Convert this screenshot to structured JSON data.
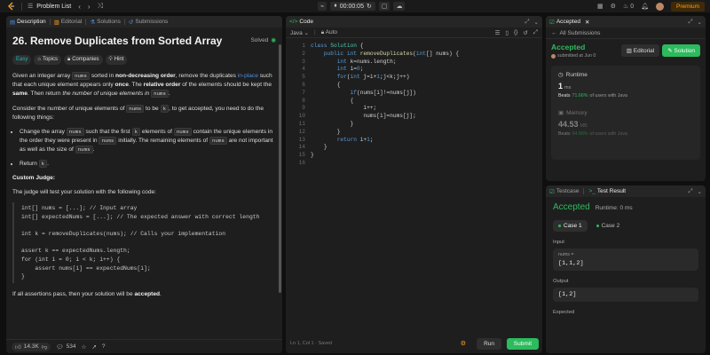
{
  "topbar": {
    "title": "Problem List",
    "timer": "00:00:05",
    "fire_count": "0",
    "premium": "Premium"
  },
  "description": {
    "tabs": [
      "Description",
      "Editorial",
      "Solutions",
      "Submissions"
    ],
    "title": "26. Remove Duplicates from Sorted Array",
    "solved": "Solved",
    "tags": [
      "Easy",
      "Topics",
      "Companies",
      "Hint"
    ],
    "p1": [
      "Given an integer array ",
      "nums",
      " sorted in ",
      "non-decreasing order",
      ", remove the duplicates ",
      "in-place",
      " such that each unique element appears only ",
      "once",
      ". The ",
      "relative order",
      " of the elements should be kept the ",
      "same",
      ". Then return ",
      "the number of unique elements in",
      " ",
      "nums",
      "."
    ],
    "p2": [
      "Consider the number of unique elements of ",
      "nums",
      " to be ",
      "k",
      ", to get accepted, you need to do the following things:"
    ],
    "bullet1": [
      "Change the array ",
      "nums",
      " such that the first ",
      "k",
      " elements of ",
      "nums",
      " contain the unique elements in the order they were present in ",
      "nums",
      " initially. The remaining elements of ",
      "nums",
      " are not important as well as the size of ",
      "nums",
      "."
    ],
    "bullet2": [
      "Return ",
      "k",
      "."
    ],
    "custom_judge": "Custom Judge:",
    "judge_intro": "The judge will test your solution with the following code:",
    "judge_code": "int[] nums = [...]; // Input array\nint[] expectedNums = [...]; // The expected answer with correct length\n\nint k = removeDuplicates(nums); // Calls your implementation\n\nassert k == expectedNums.length;\nfor (int i = 0; i < k; i++) {\n    assert nums[i] == expectedNums[i];\n}",
    "p_end": [
      "If all assertions pass, then your solution will be ",
      "accepted",
      "."
    ],
    "footer": {
      "likes": "14.3K",
      "comments": "534"
    }
  },
  "code": {
    "tab": "Code",
    "language": "Java",
    "mode": "Auto",
    "line_numbers": [
      "1",
      "2",
      "3",
      "4",
      "5",
      "6",
      "7",
      "8",
      "9",
      "10",
      "11",
      "12",
      "13",
      "14",
      "15",
      "16"
    ],
    "status": "Ln 1, Col 1  ·  Saved",
    "run": "Run",
    "submit": "Submit"
  },
  "accepted": {
    "tab": "Accepted",
    "back": "All Submissions",
    "status": "Accepted",
    "submitted": "submitted at Jun 0",
    "editorial": "Editorial",
    "solution": "Solution",
    "runtime_label": "Runtime",
    "runtime_value": "1",
    "runtime_unit": "ms",
    "runtime_beats": "Beats",
    "runtime_pct": "71.66%",
    "runtime_tail": "of users with Java",
    "memory_label": "Memory",
    "memory_value": "44.53",
    "memory_unit": "MB",
    "memory_beats": "Beats",
    "memory_pct": "94.88%",
    "memory_tail": "of users with Java"
  },
  "test": {
    "tabs": [
      "Testcase",
      "Test Result"
    ],
    "status": "Accepted",
    "runtime": "Runtime: 0 ms",
    "cases": [
      "Case 1",
      "Case 2"
    ],
    "input_label": "Input",
    "var_name": "nums =",
    "input": "[1,1,2]",
    "output_label": "Output",
    "output": "[1,2]",
    "expected_label": "Expected"
  },
  "colors": {
    "accent": "#ffa116",
    "green": "#2cbb5d",
    "blue": "#4a90e2"
  }
}
